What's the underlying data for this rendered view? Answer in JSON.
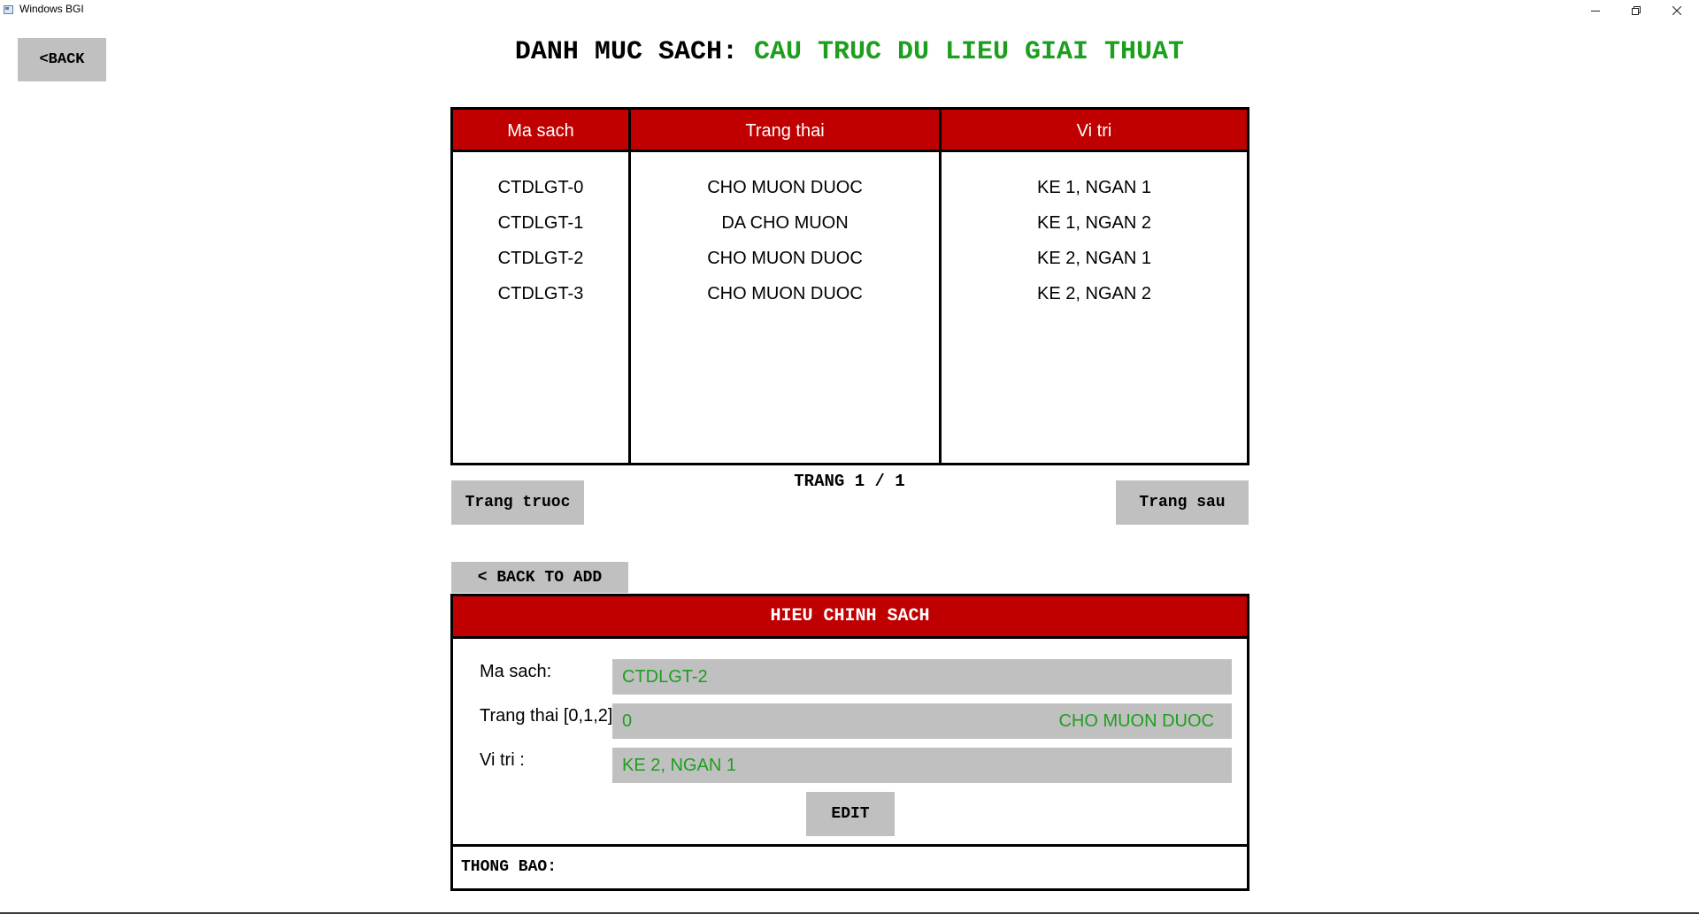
{
  "window": {
    "title": "Windows BGI",
    "controls": {
      "minimize": "minimize-icon",
      "restore": "restore-icon",
      "close": "close-icon"
    }
  },
  "back_button": "<BACK",
  "heading": {
    "prefix": "DANH MUC SACH:",
    "name": "CAU TRUC DU LIEU GIAI THUAT"
  },
  "table": {
    "headers": [
      "Ma sach",
      "Trang thai",
      "Vi tri"
    ],
    "rows": [
      [
        "CTDLGT-0",
        "CHO MUON DUOC",
        "KE 1, NGAN 1"
      ],
      [
        "CTDLGT-1",
        "DA CHO MUON",
        "KE 1, NGAN 2"
      ],
      [
        "CTDLGT-2",
        "CHO MUON DUOC",
        "KE 2, NGAN 1"
      ],
      [
        "CTDLGT-3",
        "CHO MUON DUOC",
        "KE 2, NGAN 2"
      ]
    ]
  },
  "pager": {
    "prev_label": "Trang truoc",
    "page_text": "TRANG 1 / 1",
    "next_label": "Trang sau"
  },
  "back_to_add": "< BACK TO ADD",
  "edit_panel": {
    "title": "HIEU CHINH SACH",
    "fields": {
      "code": {
        "label": "Ma sach:",
        "value": "CTDLGT-2"
      },
      "status": {
        "label": "Trang thai [0,1,2]",
        "value": "0",
        "status_text": "CHO MUON DUOC"
      },
      "location": {
        "label": "Vi tri :",
        "value": "KE 2, NGAN 1"
      }
    },
    "edit_label": "EDIT",
    "message_label": "THONG BAO:"
  },
  "colors": {
    "header_red": "#c00000",
    "value_green": "#1e9e1e",
    "button_gray": "#c0c0c0"
  }
}
